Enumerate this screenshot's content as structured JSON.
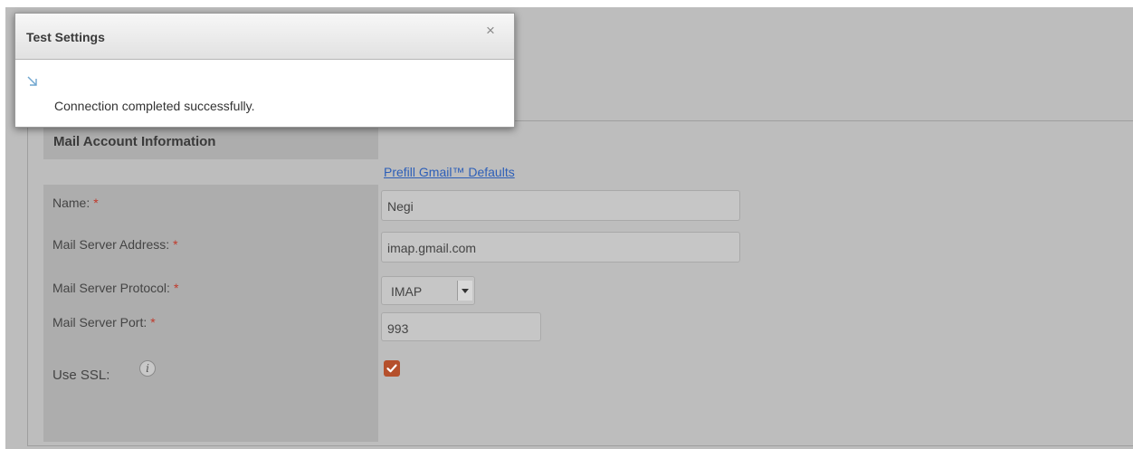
{
  "dialog": {
    "title": "Test Settings",
    "close_glyph": "×",
    "message": "Connection completed successfully.",
    "icons": {
      "close": "close-icon",
      "resize": "arrow-down-right-icon"
    }
  },
  "form": {
    "section_title": "Mail Account Information",
    "prefill_link": "Prefill Gmail™ Defaults",
    "required_marker": "*",
    "fields": {
      "name": {
        "label": "Name:",
        "value": "Negi"
      },
      "server_address": {
        "label": "Mail Server Address:",
        "value": "imap.gmail.com"
      },
      "protocol": {
        "label": "Mail Server Protocol:",
        "value": "IMAP"
      },
      "port": {
        "label": "Mail Server Port:",
        "value": "993"
      },
      "use_ssl": {
        "label": "Use SSL:",
        "checked": true,
        "info_glyph": "i"
      }
    }
  },
  "colors": {
    "overlay": "#bdbdbd",
    "link": "#2d5fb8",
    "required": "#c0392b",
    "checkbox": "#b5502c"
  }
}
